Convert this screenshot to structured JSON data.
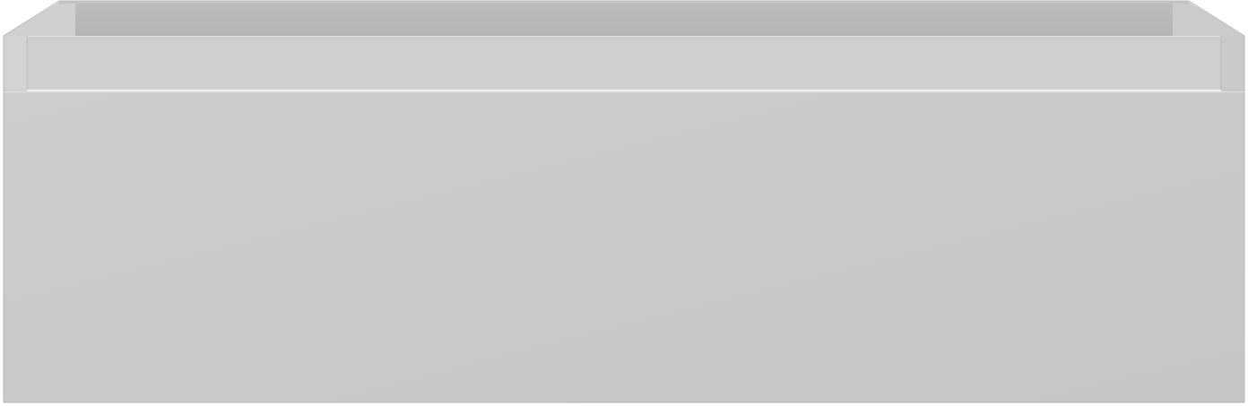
{
  "product": {
    "icon": "drawer-unit-illustration",
    "colors": {
      "background": "#ffffff",
      "inner_back_wall": "#b8b8b8",
      "inner_top_light": "#d2d2d1",
      "inner_sides": "#c9c9c8",
      "rim": "#c3c3c3",
      "inner_front": "#cfcfce",
      "front_panel_light": "#cdcdcc",
      "front_panel_dark": "#c6c6c5",
      "edge": "#b3b3b3"
    }
  }
}
